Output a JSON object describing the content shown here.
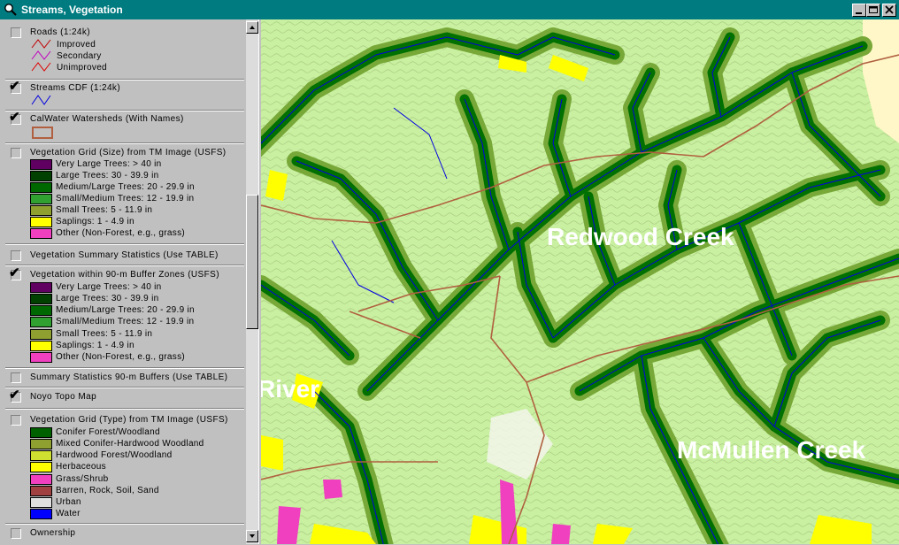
{
  "window": {
    "title": "Streams, Vegetation"
  },
  "legend": {
    "roads": {
      "title": "Roads (1:24k)",
      "checked": false,
      "items": [
        "Improved",
        "Secondary",
        "Unimproved"
      ],
      "colors": [
        "#c00000",
        "#c000c0",
        "#e00000"
      ]
    },
    "streams": {
      "title": "Streams CDF (1:24k)",
      "checked": true,
      "color": "#0000e0"
    },
    "calwater": {
      "title": "CalWater Watersheds (With Names)",
      "checked": true,
      "color": "#b06040"
    },
    "veg_size": {
      "title": "Vegetation Grid (Size) from TM Image (USFS)",
      "checked": false,
      "classes": [
        {
          "label": "Very Large Trees: > 40  in",
          "color": "#600060"
        },
        {
          "label": "Large Trees: 30 - 39.9 in",
          "color": "#004000"
        },
        {
          "label": "Medium/Large Trees: 20 - 29.9 in",
          "color": "#006800"
        },
        {
          "label": "Small/Medium Trees: 12 - 19.9 in",
          "color": "#30a030"
        },
        {
          "label": "Small Trees: 5 - 11.9 in",
          "color": "#90a030"
        },
        {
          "label": "Saplings: 1 - 4.9 in",
          "color": "#ffff00"
        },
        {
          "label": "Other (Non-Forest, e.g., grass)",
          "color": "#f040c0"
        }
      ]
    },
    "veg_summary": {
      "title": "Vegetation Summary Statistics (Use TABLE)",
      "checked": false
    },
    "veg_buffer": {
      "title": "Vegetation within 90-m Buffer Zones (USFS)",
      "checked": true,
      "classes": [
        {
          "label": "Very Large Trees: > 40  in",
          "color": "#600060"
        },
        {
          "label": "Large Trees: 30 - 39.9 in",
          "color": "#004000"
        },
        {
          "label": "Medium/Large Trees: 20 - 29.9 in",
          "color": "#006800"
        },
        {
          "label": "Small/Medium Trees: 12 - 19.9 in",
          "color": "#30a030"
        },
        {
          "label": "Small Trees: 5 - 11.9 in",
          "color": "#90a030"
        },
        {
          "label": "Saplings: 1 - 4.9 in",
          "color": "#ffff00"
        },
        {
          "label": "Other (Non-Forest, e.g., grass)",
          "color": "#f040c0"
        }
      ]
    },
    "summary_buffers": {
      "title": "Summary Statistics 90-m Buffers (Use TABLE)",
      "checked": false
    },
    "noyo_topo": {
      "title": "Noyo Topo Map",
      "checked": true
    },
    "veg_type": {
      "title": "Vegetation Grid (Type) from TM Image (USFS)",
      "checked": false,
      "classes": [
        {
          "label": "Conifer Forest/Woodland",
          "color": "#006000"
        },
        {
          "label": "Mixed Conifer-Hardwood Woodland",
          "color": "#90a030"
        },
        {
          "label": "Hardwood Forest/Woodland",
          "color": "#d0e030"
        },
        {
          "label": "Herbaceous",
          "color": "#ffff00"
        },
        {
          "label": "Grass/Shrub",
          "color": "#f040c0"
        },
        {
          "label": "Barren, Rock, Soil, Sand",
          "color": "#a04040"
        },
        {
          "label": "Urban",
          "color": "#e0e0e0"
        },
        {
          "label": "Water",
          "color": "#0000ff"
        }
      ]
    },
    "ownership": {
      "title": "Ownership",
      "checked": false
    }
  },
  "map": {
    "labels": {
      "redwood_creek": "Redwood Creek",
      "river": "River",
      "mcmullen_creek": "McMullen Creek"
    }
  }
}
